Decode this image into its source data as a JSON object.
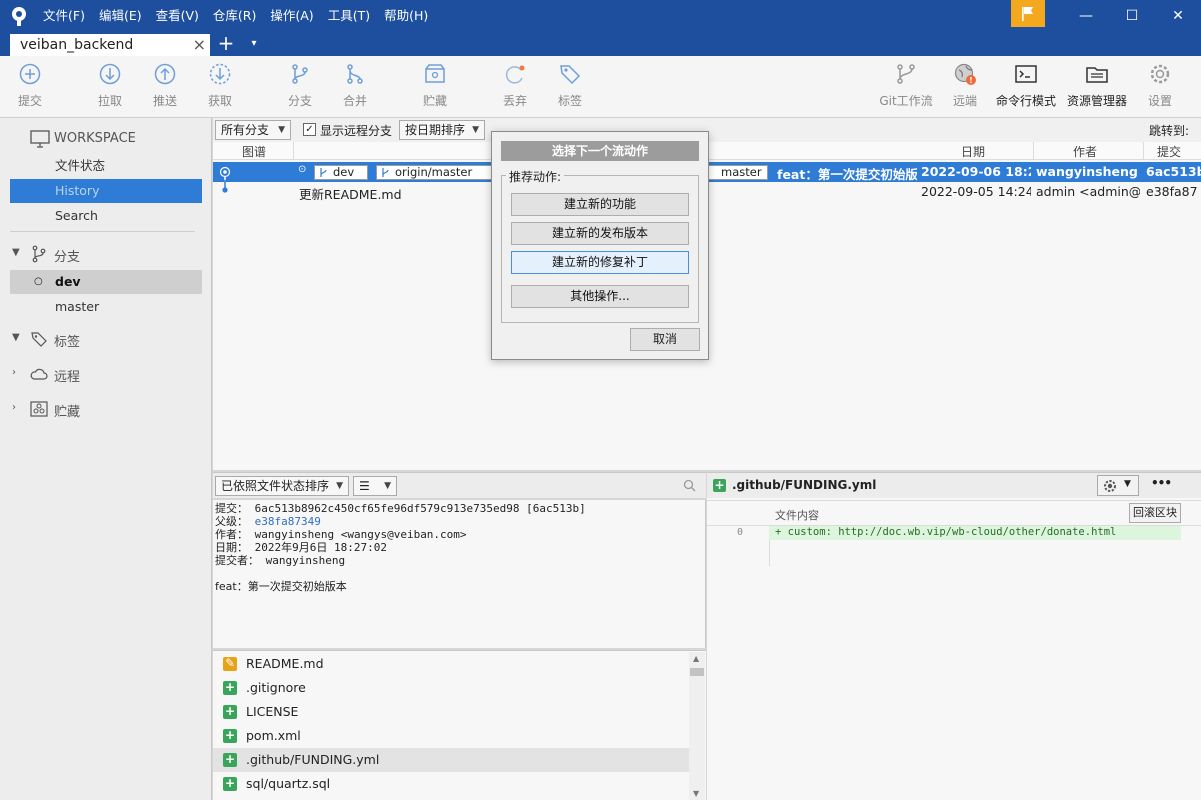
{
  "menu": [
    "文件(F)",
    "编辑(E)",
    "查看(V)",
    "仓库(R)",
    "操作(A)",
    "工具(T)",
    "帮助(H)"
  ],
  "tab": {
    "title": "veiban_backend",
    "close": "×",
    "add": "+",
    "more": "▾"
  },
  "window_controls": {
    "minimize": "—",
    "maximize": "☐",
    "close": "✕"
  },
  "toolbar": {
    "commit": "提交",
    "pull": "拉取",
    "push": "推送",
    "fetch": "获取",
    "branch": "分支",
    "merge": "合并",
    "stash": "贮藏",
    "discard": "丢弃",
    "tag": "标签",
    "gitflow": "Git工作流",
    "remote": "远端",
    "terminal": "命令行模式",
    "explorer": "资源管理器",
    "settings": "设置"
  },
  "sidebar": {
    "workspace": "WORKSPACE",
    "file_status": "文件状态",
    "history": "History",
    "search": "Search",
    "branches": "分支",
    "branch_dev": "dev",
    "branch_master": "master",
    "tags": "标签",
    "remotes": "远程",
    "stashes": "贮藏"
  },
  "graph_bar": {
    "branch_filter": "所有分支",
    "show_remote": "显示远程分支",
    "sort": "按日期排序",
    "jump_to": "跳转到:"
  },
  "columns": {
    "graph": "图谱",
    "date": "日期",
    "author": "作者",
    "commit": "提交"
  },
  "commits": [
    {
      "refs": [
        "dev",
        "origin/master",
        "master"
      ],
      "message": "feat：第一次提交初始版",
      "date": "2022-09-06 18:27",
      "author": "wangyinsheng <",
      "hash": "6ac513b"
    },
    {
      "message": "更新README.md",
      "date": "2022-09-05 14:24",
      "author": "admin <admin@",
      "hash": "e38fa87"
    }
  ],
  "detail_bar": {
    "sort": "已依照文件状态排序"
  },
  "detail": {
    "commit_label": "提交：",
    "commit_value": "6ac513b8962c450cf65fe96df579c913e735ed98 [6ac513b]",
    "parent_label": "父级：",
    "parent_value": "e38fa87349",
    "author_label": "作者：",
    "author_value": "wangyinsheng <wangys@veiban.com>",
    "date_label": "日期：",
    "date_value": "2022年9月6日 18:27:02",
    "committer_label": "提交者：",
    "committer_value": "wangyinsheng",
    "message": "feat：第一次提交初始版本"
  },
  "files": [
    {
      "name": "README.md",
      "status": "modified"
    },
    {
      "name": ".gitignore",
      "status": "added"
    },
    {
      "name": "LICENSE",
      "status": "added"
    },
    {
      "name": "pom.xml",
      "status": "added"
    },
    {
      "name": ".github/FUNDING.yml",
      "status": "added"
    },
    {
      "name": "sql/quartz.sql",
      "status": "added"
    }
  ],
  "diff": {
    "file": ".github/FUNDING.yml",
    "content_label": "文件内容",
    "revert_hunk": "回滚区块",
    "line_no": "0",
    "line": "+ custom: http://doc.wb.vip/wb-cloud/other/donate.html",
    "more": "•••"
  },
  "dialog": {
    "title": "选择下一个流动作",
    "group_label": "推荐动作:",
    "btn_feature": "建立新的功能",
    "btn_release": "建立新的发布版本",
    "btn_hotfix": "建立新的修复补丁",
    "btn_other": "其他操作...",
    "btn_cancel": "取消"
  },
  "colors": {
    "titlebar": "#1e4f9e",
    "selection": "#2f7cd6",
    "flag": "#f4a81d",
    "added": "#3aa55a",
    "modified": "#e8a21a"
  }
}
